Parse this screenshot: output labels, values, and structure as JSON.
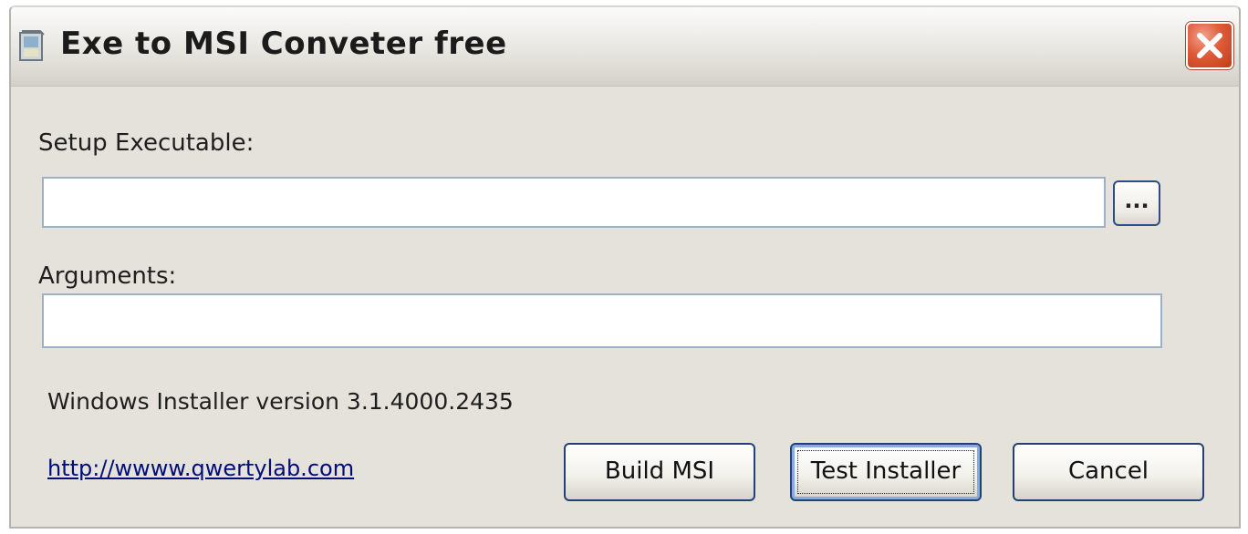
{
  "window": {
    "title": "Exe to MSI Conveter free",
    "app_icon": "installer-box-icon",
    "close_icon": "close-x-icon"
  },
  "form": {
    "setup_label": "Setup Executable:",
    "setup_value": "",
    "browse_label": "...",
    "arguments_label": "Arguments:",
    "arguments_value": ""
  },
  "info": {
    "installer_version": "Windows Installer version 3.1.4000.2435",
    "website_link": "http://wwww.qwertylab.com"
  },
  "buttons": {
    "build": "Build MSI",
    "test": "Test Installer",
    "cancel": "Cancel"
  },
  "colors": {
    "window_bg": "#e4e2da",
    "close_red": "#d8512f",
    "button_border": "#1f4379",
    "link": "#000d7a"
  }
}
